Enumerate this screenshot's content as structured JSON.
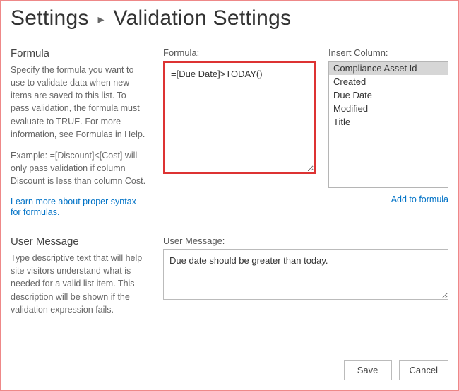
{
  "breadcrumb": {
    "root": "Settings",
    "separator": "▸",
    "current": "Validation Settings"
  },
  "formula_section": {
    "title": "Formula",
    "help1": "Specify the formula you want to use to validate data when new items are saved to this list. To pass validation, the formula must evaluate to TRUE. For more information, see Formulas in Help.",
    "help2": "Example: =[Discount]<[Cost] will only pass validation if column Discount is less than column Cost.",
    "learn_more": "Learn more about proper syntax for formulas.",
    "field_label": "Formula:",
    "value": "=[Due Date]>TODAY()",
    "insert_label": "Insert Column:",
    "columns": [
      {
        "label": "Compliance Asset Id",
        "selected": true
      },
      {
        "label": "Created",
        "selected": false
      },
      {
        "label": "Due Date",
        "selected": false
      },
      {
        "label": "Modified",
        "selected": false
      },
      {
        "label": "Title",
        "selected": false
      }
    ],
    "add_to_formula": "Add to formula"
  },
  "usermsg_section": {
    "title": "User Message",
    "help": "Type descriptive text that will help site visitors understand what is needed for a valid list item. This description will be shown if the validation expression fails.",
    "field_label": "User Message:",
    "value": "Due date should be greater than today."
  },
  "buttons": {
    "save": "Save",
    "cancel": "Cancel"
  }
}
